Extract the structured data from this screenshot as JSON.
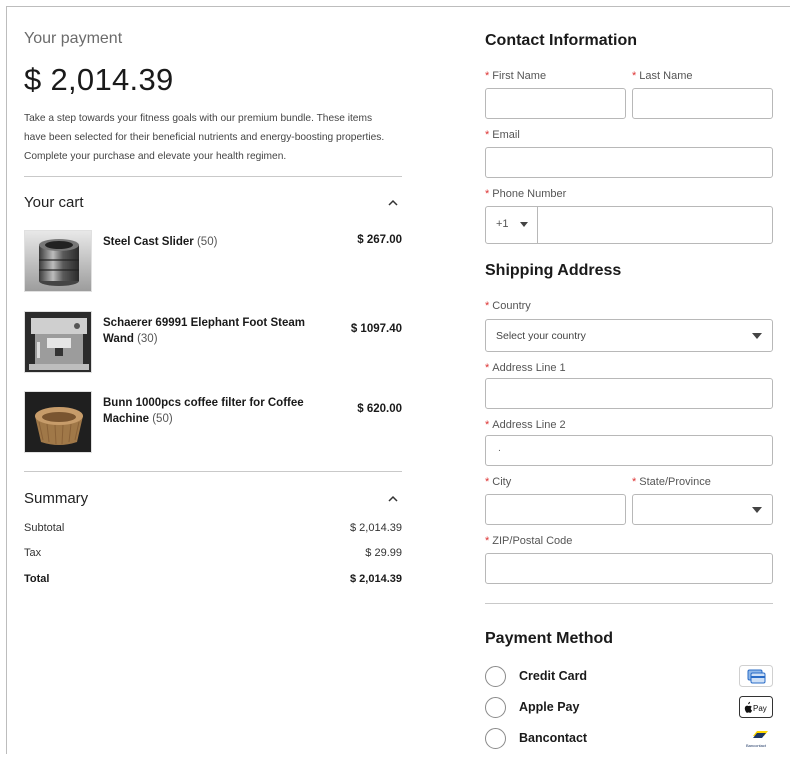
{
  "payment": {
    "label": "Your payment",
    "amount": "$ 2,014.39",
    "description": "Take a step towards your fitness goals with our premium bundle. These items have been selected for their beneficial nutrients and energy-boosting properties. Complete your purchase and elevate your health regimen."
  },
  "cart": {
    "title": "Your cart",
    "items": [
      {
        "name": "Steel Cast Slider",
        "qty": "(50)",
        "price": "$ 267.00",
        "thumb_icon": "steel-cast-slider-image"
      },
      {
        "name": "Schaerer 69991 Elephant Foot Steam Wand",
        "qty": "(30)",
        "price": "$ 1097.40",
        "thumb_icon": "espresso-machine-image"
      },
      {
        "name": "Bunn 1000pcs coffee filter for Coffee Machine",
        "qty": "(50)",
        "price": "$ 620.00",
        "thumb_icon": "coffee-filter-image"
      }
    ]
  },
  "summary": {
    "title": "Summary",
    "rows": [
      {
        "label": "Subtotal",
        "value": "$ 2,014.39"
      },
      {
        "label": "Tax",
        "value": "$ 29.99"
      },
      {
        "label": "Total",
        "value": "$ 2,014.39"
      }
    ]
  },
  "contact": {
    "title": "Contact Information",
    "first_name_label": "First Name",
    "last_name_label": "Last Name",
    "email_label": "Email",
    "phone_label": "Phone Number",
    "country_code": "+1"
  },
  "shipping": {
    "title": "Shipping Address",
    "country_label": "Country",
    "country_placeholder": "Select your country",
    "address1_label": "Address Line 1",
    "address2_label": "Address Line 2",
    "address2_value": ".",
    "city_label": "City",
    "state_label": "State/Province",
    "zip_label": "ZIP/Postal Code"
  },
  "payment_method": {
    "title": "Payment Method",
    "options": [
      {
        "label": "Credit Card",
        "icon": "credit-card-icon"
      },
      {
        "label": "Apple Pay",
        "icon": "apple-pay-icon",
        "icon_text": "Pay"
      },
      {
        "label": "Bancontact",
        "icon": "bancontact-icon",
        "icon_text": "Bancontact"
      }
    ]
  },
  "colors": {
    "required": "#d33333",
    "border": "#b8b8b8",
    "text": "#1a1a1a"
  }
}
